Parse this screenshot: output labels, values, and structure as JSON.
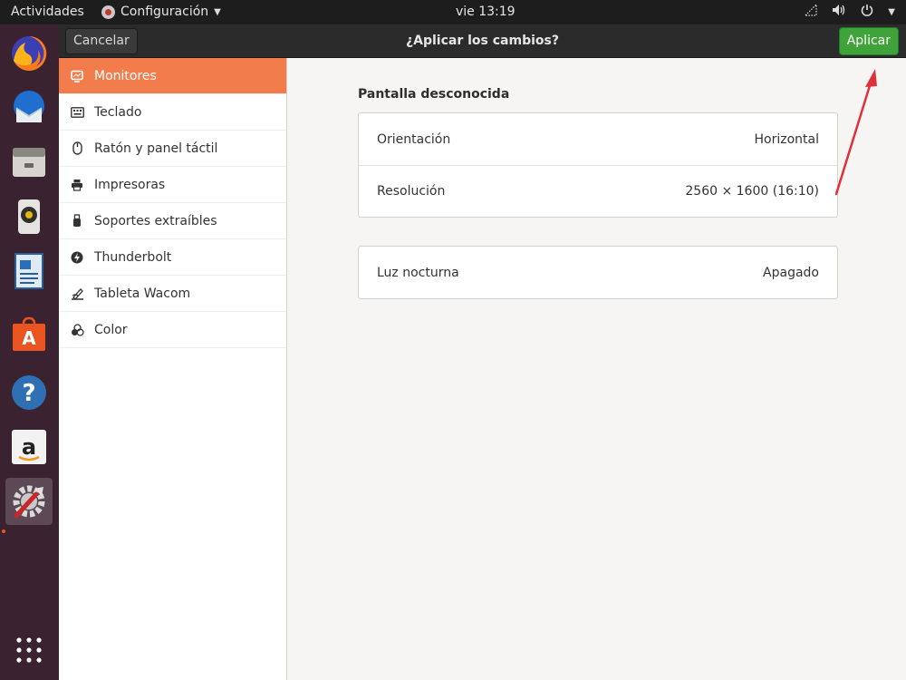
{
  "topbar": {
    "activities": "Actividades",
    "app_menu": "Configuración",
    "clock": "vie 13:19"
  },
  "header": {
    "cancel_label": "Cancelar",
    "title": "¿Aplicar los cambios?",
    "apply_label": "Aplicar"
  },
  "sidebar": {
    "items": [
      {
        "label": "Monitores",
        "icon": "display-icon",
        "selected": true
      },
      {
        "label": "Teclado",
        "icon": "keyboard-icon"
      },
      {
        "label": "Ratón y panel táctil",
        "icon": "mouse-icon"
      },
      {
        "label": "Impresoras",
        "icon": "printer-icon"
      },
      {
        "label": "Soportes extraíbles",
        "icon": "removable-media-icon"
      },
      {
        "label": "Thunderbolt",
        "icon": "thunderbolt-icon"
      },
      {
        "label": "Tableta Wacom",
        "icon": "tablet-icon"
      },
      {
        "label": "Color",
        "icon": "color-icon"
      }
    ]
  },
  "main": {
    "section_title": "Pantalla desconocida",
    "display_card": {
      "orientation_label": "Orientación",
      "orientation_value": "Horizontal",
      "resolution_label": "Resolución",
      "resolution_value": "2560 × 1600 (16:10)"
    },
    "night_light": {
      "label": "Luz nocturna",
      "value": "Apagado"
    }
  },
  "dock": {
    "apps": [
      "firefox-icon",
      "thunderbird-icon",
      "files-icon",
      "rhythmbox-icon",
      "libreoffice-writer-icon",
      "software-center-icon",
      "help-icon",
      "amazon-icon",
      "settings-icon",
      "show-applications-icon"
    ]
  },
  "colors": {
    "accent": "#f27c4c",
    "apply_button": "#3fa33a",
    "annotation_arrow": "#e0303a"
  }
}
